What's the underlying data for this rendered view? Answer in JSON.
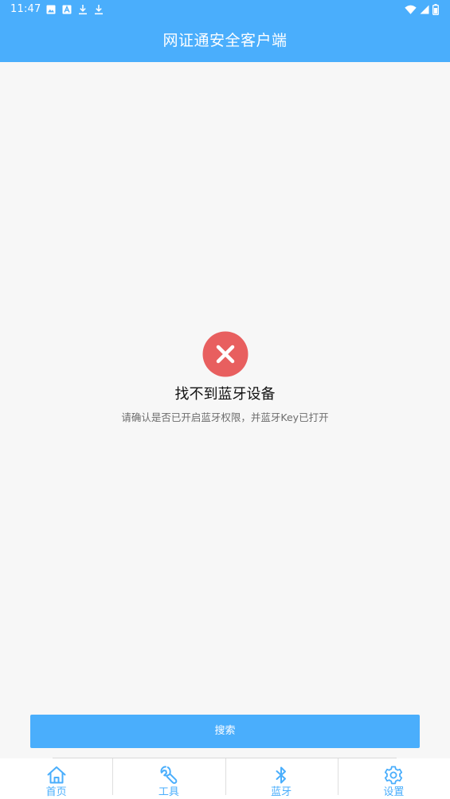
{
  "status_bar": {
    "time": "11:47",
    "left_icons": [
      "image-icon",
      "font-icon",
      "download-icon",
      "download-icon"
    ],
    "right_icons": [
      "wifi-icon",
      "signal-icon",
      "battery-icon"
    ]
  },
  "header": {
    "title": "网证通安全客户端"
  },
  "error": {
    "icon": "error-x-icon",
    "title": "找不到蓝牙设备",
    "description": "请确认是否已开启蓝牙权限，并蓝牙Key已打开"
  },
  "actions": {
    "search_label": "搜索"
  },
  "bottom_nav": {
    "items": [
      {
        "label": "首页",
        "icon": "home-icon"
      },
      {
        "label": "工具",
        "icon": "wrench-icon"
      },
      {
        "label": "蓝牙",
        "icon": "bluetooth-icon"
      },
      {
        "label": "设置",
        "icon": "gear-icon"
      }
    ]
  },
  "colors": {
    "accent": "#4aaefc",
    "error": "#e85f5f",
    "background": "#f7f7f7"
  }
}
